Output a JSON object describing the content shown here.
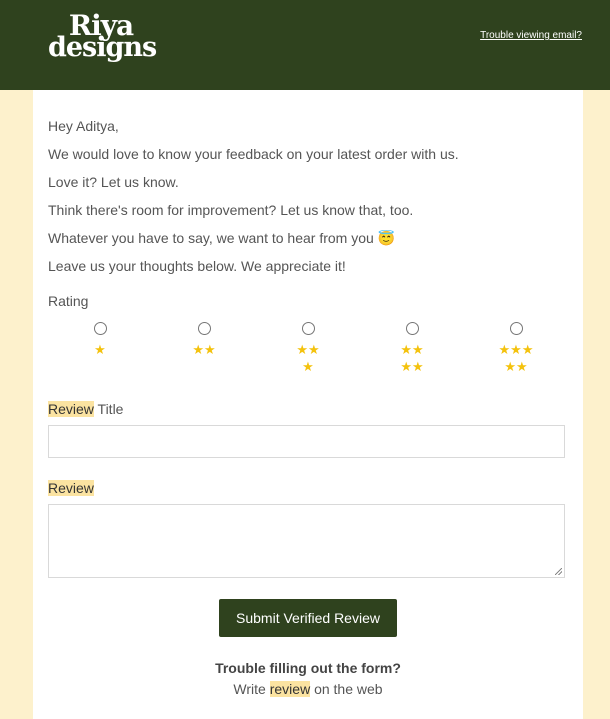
{
  "header": {
    "logo_line1": "Riya",
    "logo_line2": "designs",
    "trouble_link": "Trouble viewing email?"
  },
  "intro": {
    "greeting": "Hey Aditya,",
    "line1": "We would love to know your feedback on your latest order with us.",
    "line2": "Love it? Let us know.",
    "line3": "Think there's room for improvement? Let us know that, too.",
    "line4": "Whatever you have to say, we want to hear from you 😇",
    "line5": "Leave us your thoughts below. We appreciate it!"
  },
  "rating": {
    "label": "Rating",
    "options": [
      {
        "stars": "★",
        "value": 1
      },
      {
        "stars": "★★",
        "value": 2
      },
      {
        "stars": "★★★",
        "value": 3
      },
      {
        "stars": "★★★★",
        "value": 4
      },
      {
        "stars": "★★★★★",
        "value": 5
      }
    ]
  },
  "form": {
    "title_label_hl": "Review",
    "title_label_rest": " Title",
    "title_value": "",
    "review_label": "Review",
    "review_value": "",
    "submit_label": "Submit Verified Review"
  },
  "footer": {
    "question": "Trouble filling out the form?",
    "answer_pre": "Write ",
    "answer_link": "review",
    "answer_post": " on the web"
  },
  "colors": {
    "brand_green": "#2f421e",
    "page_bg": "#fdf1cc",
    "star": "#f4c20d",
    "highlight": "#fbe3a1"
  }
}
